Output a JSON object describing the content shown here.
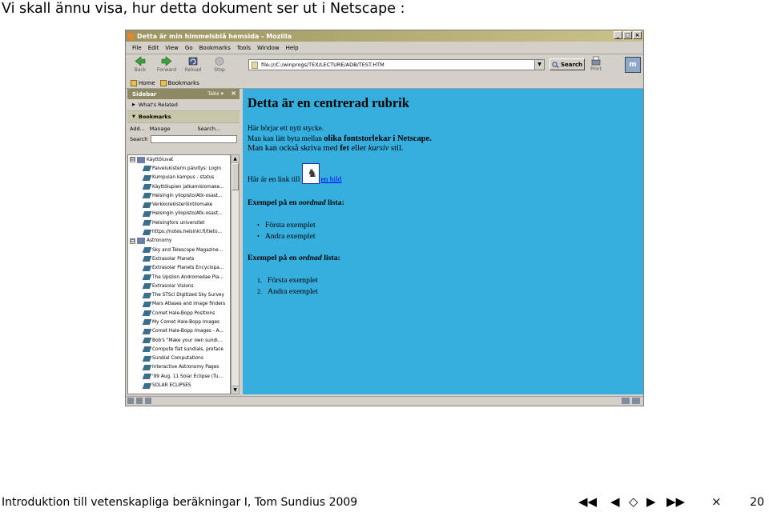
{
  "slide": {
    "title": "Vi skall ännu visa, hur detta dokument ser ut i Netscape :",
    "footer": "Introduktion till vetenskapliga beräkningar I, Tom Sundius 2009",
    "page_number": "20",
    "nav": {
      "first": "◀◀",
      "prev": "◀",
      "home": "◇",
      "next": "▶",
      "last": "▶▶",
      "close": "×"
    }
  },
  "browser": {
    "title": "Detta är min himmelsblå hemsida - Mozilla",
    "window_buttons": {
      "min": "_",
      "max": "□",
      "close": "×"
    },
    "menu": [
      "File",
      "Edit",
      "View",
      "Go",
      "Bookmarks",
      "Tools",
      "Window",
      "Help"
    ],
    "nav_buttons": {
      "back": "Back",
      "forward": "Forward",
      "reload": "Reload",
      "stop": "Stop"
    },
    "url": "file:///C:/winprogs/TEX/LECTURE/ADB/TEST.HTM",
    "url_dropdown": "▼",
    "search_label": "Search",
    "print_label": "Print",
    "throbber_label": "m",
    "personal": [
      "Home",
      "Bookmarks"
    ]
  },
  "sidebar": {
    "title": "Sidebar",
    "tabs_label": "Tabs ▾",
    "close": "×",
    "whats_related": "What's Related",
    "bookmarks": "Bookmarks",
    "tools": {
      "add": "Add...",
      "manage": "Manage",
      "search": "Search..."
    },
    "search_label": "Search",
    "tree": [
      {
        "type": "folder",
        "toggle": "⊟",
        "label": "Käyttöluvat"
      },
      {
        "type": "item",
        "label": "Palvelukisterin päivitys: Login"
      },
      {
        "type": "item",
        "label": "Kumpulan kampus - status"
      },
      {
        "type": "item",
        "label": "Käyttölupien jatkamislomake..."
      },
      {
        "type": "item",
        "label": "Helsingin yliopisto/Atk-osast..."
      },
      {
        "type": "item",
        "label": "Verkkorekisteröintilomake"
      },
      {
        "type": "item",
        "label": "Helsingin yliopisto/Atk-osast..."
      },
      {
        "type": "item",
        "label": "Helsingfors universitet"
      },
      {
        "type": "item",
        "label": "https://notes.helsinki.fi/tieto..."
      },
      {
        "type": "folder",
        "toggle": "⊟",
        "label": "Astronomy"
      },
      {
        "type": "item",
        "label": "Sky and Telescope Magazine..."
      },
      {
        "type": "item",
        "label": "Extrasolar Planets"
      },
      {
        "type": "item",
        "label": "Extrasolar Planets Encyclopa..."
      },
      {
        "type": "item",
        "label": "The Upsilon Andromedae Pla..."
      },
      {
        "type": "item",
        "label": "Extrasolar Visions"
      },
      {
        "type": "item",
        "label": "The STScI Digitized Sky Survey"
      },
      {
        "type": "item",
        "label": "Mars Atlases and image finders"
      },
      {
        "type": "item",
        "label": "Comet Hale-Bopp Positions"
      },
      {
        "type": "item",
        "label": "My Comet Hale-Bopp Images"
      },
      {
        "type": "item",
        "label": "Comet Hale-Bopp Images - A..."
      },
      {
        "type": "item",
        "label": "Bob's \"Make your own sundi..."
      },
      {
        "type": "item",
        "label": "Compute flat sundials, preface"
      },
      {
        "type": "item",
        "label": "Sundial Computations"
      },
      {
        "type": "item",
        "label": "Interactive Astronomy Pages"
      },
      {
        "type": "item",
        "label": "'99 Aug. 11 Solar Eclipse (Tu..."
      },
      {
        "type": "item",
        "label": "SOLAR ECLIPSES"
      }
    ]
  },
  "page": {
    "heading": "Detta är en centrerad rubrik",
    "line1": "Här börjar ett nytt stycke.",
    "line2_a": "Man kan lätt byta mellan ",
    "line2_b": "olika fontstorlekar i Netscape.",
    "line3_a": "Man kan också skriva med ",
    "line3_b": "fet",
    "line3_c": " eller ",
    "line3_d": "kursiv",
    "line3_e": " stil.",
    "link_prefix": "Här är en link till",
    "link_text": "en bild",
    "ul_heading_a": "Exempel på en ",
    "ul_heading_b": "oordnad",
    "ul_heading_c": " lista:",
    "ul_items": [
      "Första exemplet",
      "Andra exemplet"
    ],
    "ol_heading_a": "Exempel på en ",
    "ol_heading_b": "ordnad",
    "ol_heading_c": " lista:",
    "ol_items": [
      "Första exemplet",
      "Andra exemplet"
    ],
    "ol_numbers": [
      "1.",
      "2."
    ]
  },
  "colors": {
    "content_bg": "#36aede",
    "link": "#0000ee",
    "sidebar_head": "#8d8a63"
  }
}
